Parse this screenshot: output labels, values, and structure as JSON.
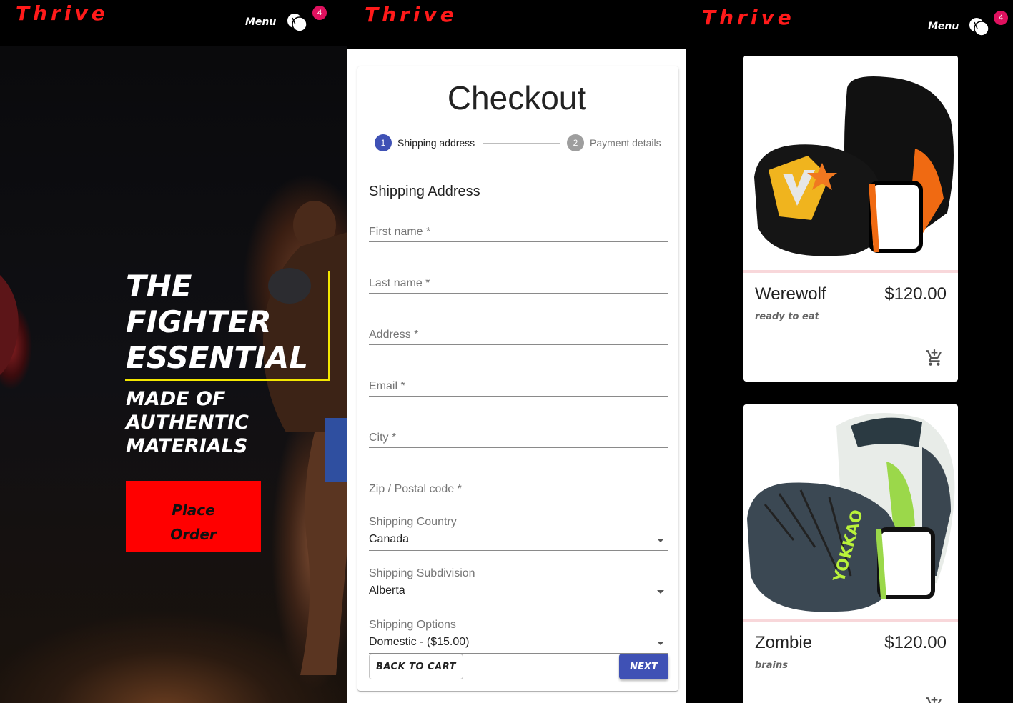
{
  "left_panel": {
    "logo": "Thrive",
    "menu_label": "Menu",
    "cart_count": "4",
    "headline": [
      "THE",
      "FIGHTER",
      "ESSENTIAL"
    ],
    "subline": [
      "MADE OF",
      "AUTHENTIC",
      "MATERIALS"
    ],
    "cta": [
      "Place",
      "Order"
    ],
    "colors": {
      "cta_bg": "#ff0000",
      "accent": "#f3e600",
      "logo": "#ff1a1a"
    }
  },
  "checkout": {
    "logo": "Thrive",
    "title": "Checkout",
    "steps": [
      {
        "number": "1",
        "label": "Shipping address",
        "active": true
      },
      {
        "number": "2",
        "label": "Payment details",
        "active": false
      }
    ],
    "section_title": "Shipping Address",
    "fields": {
      "first_name": "First name *",
      "last_name": "Last name *",
      "address": "Address *",
      "email": "Email *",
      "city": "City *",
      "zip": "Zip / Postal code *"
    },
    "selects": {
      "country_label": "Shipping Country",
      "country_value": "Canada",
      "subdivision_label": "Shipping Subdivision",
      "subdivision_value": "Alberta",
      "options_label": "Shipping Options",
      "options_value": "Domestic - ($15.00)"
    },
    "buttons": {
      "back": "BACK TO CART",
      "next": "NEXT"
    },
    "colors": {
      "primary": "#3f51b5"
    }
  },
  "products_panel": {
    "logo": "Thrive",
    "menu_label": "Menu",
    "cart_count": "4",
    "products": [
      {
        "name": "Werewolf",
        "price": "$120.00",
        "description": "ready to eat"
      },
      {
        "name": "Zombie",
        "price": "$120.00",
        "description": "brains"
      }
    ]
  }
}
